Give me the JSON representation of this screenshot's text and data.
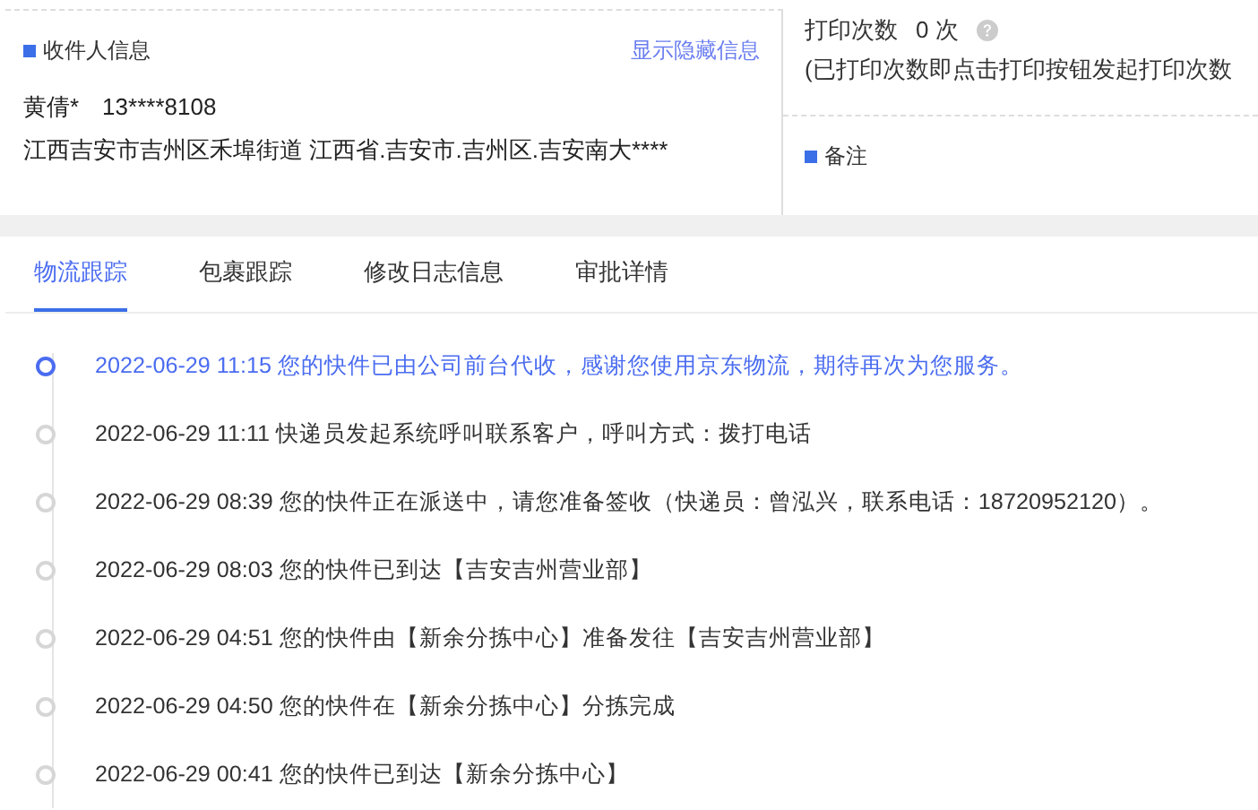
{
  "recipient": {
    "title": "收件人信息",
    "link": "显示隐藏信息",
    "name_phone": "黄倩*　13****8108",
    "address": "江西吉安市吉州区禾埠街道 江西省.吉安市.吉州区.吉安南大****"
  },
  "print": {
    "label": "打印次数",
    "count": "0 次",
    "note": "(已打印次数即点击打印按钮发起打印次数"
  },
  "remark": {
    "title": "备注"
  },
  "tabs": [
    {
      "label": "物流跟踪",
      "selected": true
    },
    {
      "label": "包裹跟踪",
      "selected": false
    },
    {
      "label": "修改日志信息",
      "selected": false
    },
    {
      "label": "审批详情",
      "selected": false
    }
  ],
  "timeline": [
    {
      "text": "2022-06-29 11:15 您的快件已由公司前台代收，感谢您使用京东物流，期待再次为您服务。",
      "active": true
    },
    {
      "text": "2022-06-29 11:11 快递员发起系统呼叫联系客户，呼叫方式：拨打电话",
      "active": false
    },
    {
      "text": "2022-06-29 08:39 您的快件正在派送中，请您准备签收（快递员：曾泓兴，联系电话：18720952120）。",
      "active": false
    },
    {
      "text": "2022-06-29 08:03 您的快件已到达【吉安吉州营业部】",
      "active": false
    },
    {
      "text": "2022-06-29 04:51 您的快件由【新余分拣中心】准备发往【吉安吉州营业部】",
      "active": false
    },
    {
      "text": "2022-06-29 04:50 您的快件在【新余分拣中心】分拣完成",
      "active": false
    },
    {
      "text": "2022-06-29 00:41 您的快件已到达【新余分拣中心】",
      "active": false
    }
  ]
}
